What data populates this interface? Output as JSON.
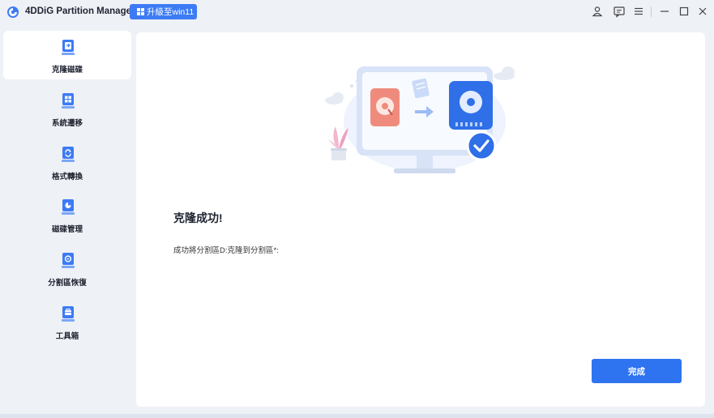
{
  "app": {
    "title": "4DDiG Partition Manager",
    "upgrade_label": "升級至win11",
    "accent": "#3d7bf4"
  },
  "titlebar_icons": [
    "user-icon",
    "feedback-icon",
    "menu-icon",
    "minimize-icon",
    "maximize-icon",
    "close-icon"
  ],
  "sidebar": {
    "items": [
      {
        "label": "克隆磁碟",
        "icon": "clone-disk-icon",
        "active": true
      },
      {
        "label": "系統遷移",
        "icon": "system-migrate-icon",
        "active": false
      },
      {
        "label": "格式轉換",
        "icon": "format-convert-icon",
        "active": false
      },
      {
        "label": "磁碟管理",
        "icon": "disk-manage-icon",
        "active": false
      },
      {
        "label": "分割區恢復",
        "icon": "partition-recovery-icon",
        "active": false
      },
      {
        "label": "工具箱",
        "icon": "toolbox-icon",
        "active": false
      }
    ]
  },
  "main": {
    "result_title": "克隆成功!",
    "result_desc": "成功將分割區D:克隆到分割區*:",
    "done_label": "完成"
  }
}
